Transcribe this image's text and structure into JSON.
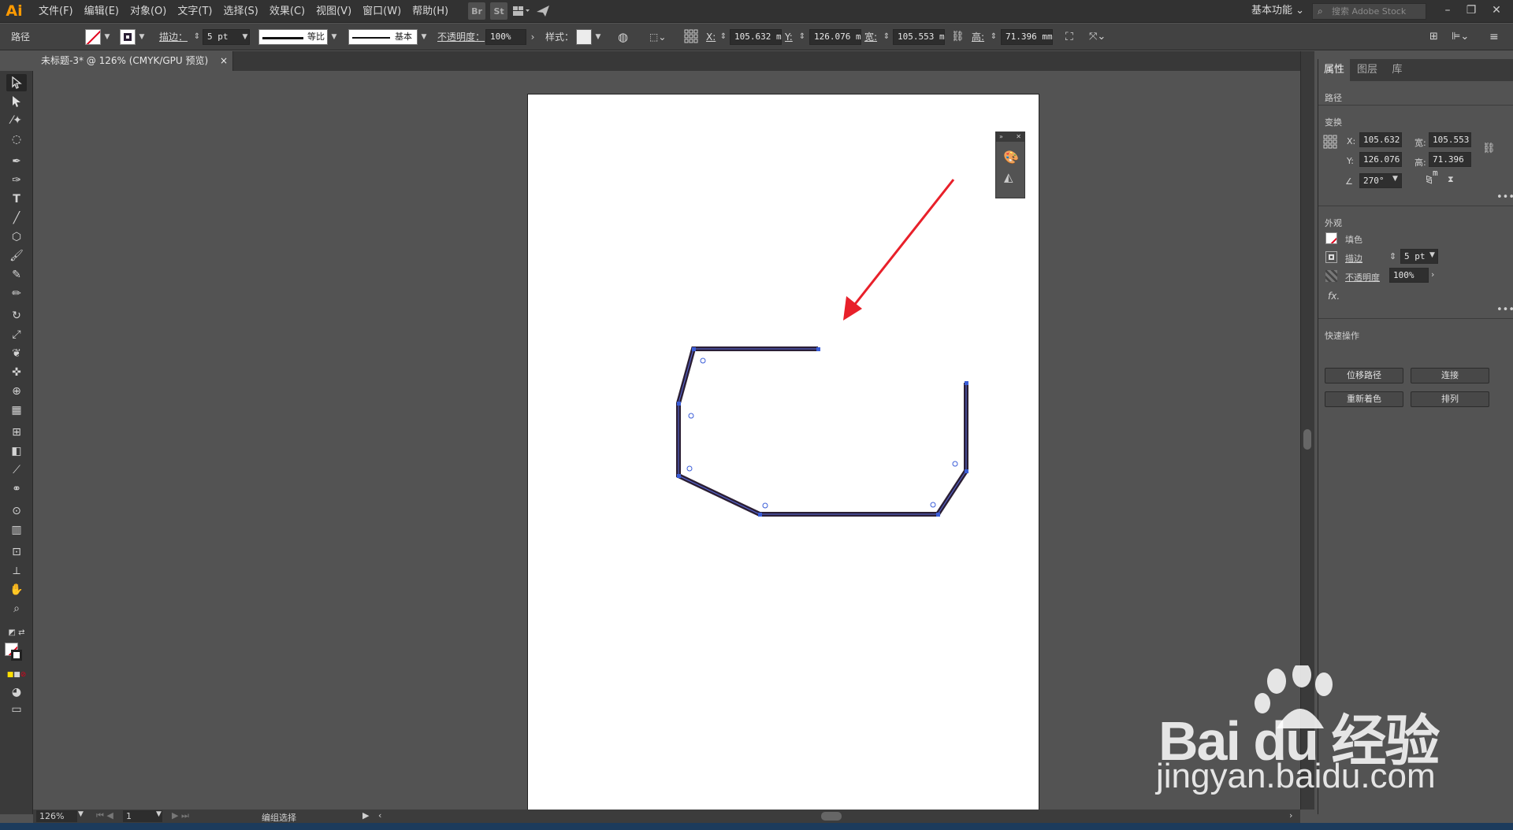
{
  "app": {
    "logo": "Ai"
  },
  "menu": [
    "文件(F)",
    "编辑(E)",
    "对象(O)",
    "文字(T)",
    "选择(S)",
    "效果(C)",
    "视图(V)",
    "窗口(W)",
    "帮助(H)"
  ],
  "menubar_icons": {
    "br": "Br",
    "st": "St"
  },
  "workspace": "基本功能",
  "stock_search_placeholder": "搜索 Adobe Stock",
  "control": {
    "object_type": "路径",
    "stroke_label": "描边：",
    "stroke_value": "5 pt",
    "profile": "等比",
    "brush": "基本",
    "opacity_label": "不透明度：",
    "opacity_value": "100%",
    "style_label": "样式：",
    "x_label": "X:",
    "x_value": "105.632 m",
    "y_label": "Y:",
    "y_value": "126.076 m",
    "w_label": "宽:",
    "w_value": "105.553 m",
    "h_label": "高:",
    "h_value": "71.396 mm"
  },
  "document_tab": "未标题-3* @ 126% (CMYK/GPU 预览)",
  "right_panel": {
    "tabs": [
      "属性",
      "图层",
      "库"
    ],
    "object_type": "路径",
    "transform_title": "变换",
    "x_label": "X:",
    "x_value": "105.632",
    "y_label": "Y:",
    "y_value": "126.076",
    "w_label": "宽:",
    "w_value": "105.553",
    "h_label": "高:",
    "h_value": "71.396 m",
    "angle_value": "270°",
    "appearance_title": "外观",
    "fill_label": "填色",
    "stroke_label": "描边",
    "stroke_value": "5 pt",
    "opacity_label": "不透明度",
    "opacity_value": "100%",
    "fx_label": "fx.",
    "quick_actions_title": "快速操作",
    "quick_buttons": [
      "位移路径",
      "连接",
      "重新着色",
      "排列"
    ]
  },
  "status": {
    "zoom": "126%",
    "artboard_num": "1",
    "tool_name": "编组选择"
  },
  "watermark": {
    "brand": "Bai du 经验",
    "url": "jingyan.baidu.com"
  },
  "colors": {
    "accent": "#ff9a00",
    "path_stroke": "#2b1f35",
    "anchor": "#3a5dd8",
    "arrow": "#e8202a"
  }
}
